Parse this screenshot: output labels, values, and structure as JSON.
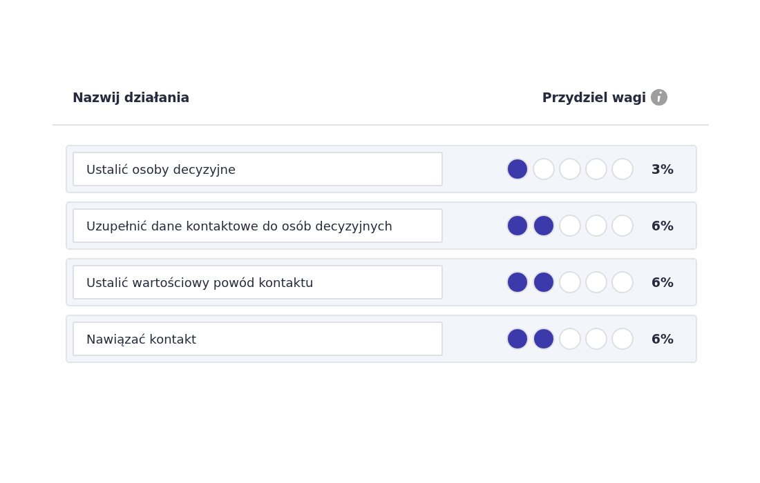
{
  "header": {
    "name_label": "Nazwij działania",
    "weight_label": "Przydziel wagi"
  },
  "rows": [
    {
      "value": "Ustalić osoby decyzyjne",
      "stars": 1,
      "percent": "3%"
    },
    {
      "value": "Uzupełnić dane kontaktowe do osób decyzyjnych",
      "stars": 2,
      "percent": "6%"
    },
    {
      "value": "Ustalić wartościowy powód kontaktu",
      "stars": 2,
      "percent": "6%"
    },
    {
      "value": "Nawiązać kontakt",
      "stars": 2,
      "percent": "6%"
    }
  ]
}
